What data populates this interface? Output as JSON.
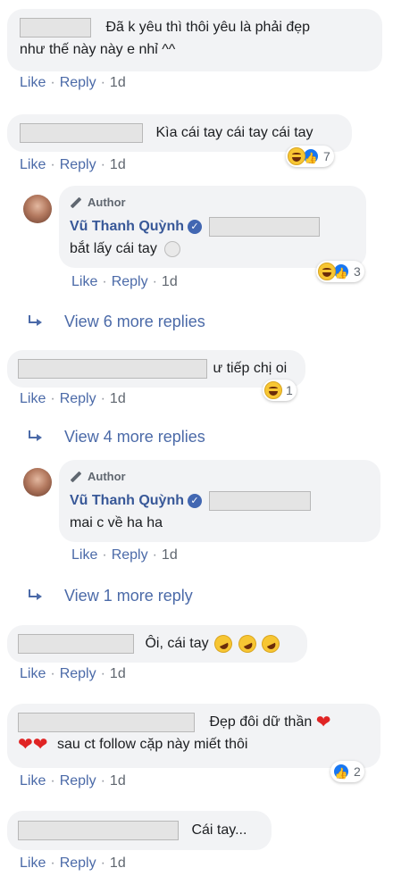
{
  "actions": {
    "like": "Like",
    "reply": "Reply",
    "time": "1d",
    "sep": "·"
  },
  "comments": [
    {
      "text_a": "Đã k yêu thì thôi yêu là phải đẹp",
      "text_b": "như thế này này e nhỉ ^^"
    },
    {
      "text": "Kìa cái tay cái tay cái tay",
      "reactions": {
        "icons": [
          "laugh-icon",
          "like-icon"
        ],
        "count": "7"
      }
    },
    {
      "author": "Vũ Thanh Quỳnh",
      "badge": "Author",
      "text": "bắt lấy cái tay",
      "emoji": "moon-face-icon",
      "reactions": {
        "icons": [
          "laugh-icon",
          "like-icon"
        ],
        "count": "3"
      }
    },
    {
      "text": "ư tiếp chị oi",
      "reactions": {
        "icons": [
          "laugh-icon"
        ],
        "count": "1"
      }
    },
    {
      "author": "Vũ Thanh Quỳnh",
      "badge": "Author",
      "text": "mai c về ha ha"
    },
    {
      "text": "Ôi, cái tay",
      "emoji": "rofl-icon"
    },
    {
      "text_a": "Đẹp đôi dữ thần",
      "text_b": "sau ct follow cặp này miết thôi",
      "reactions": {
        "icons": [
          "like-icon"
        ],
        "count": "2"
      }
    },
    {
      "text": "Cái tay..."
    }
  ],
  "view_more": [
    "View 6 more replies",
    "View 4 more replies",
    "View 1 more reply"
  ],
  "colors": {
    "link": "#4b6aa8",
    "bubble": "#f2f3f5",
    "author_name": "#385898"
  }
}
